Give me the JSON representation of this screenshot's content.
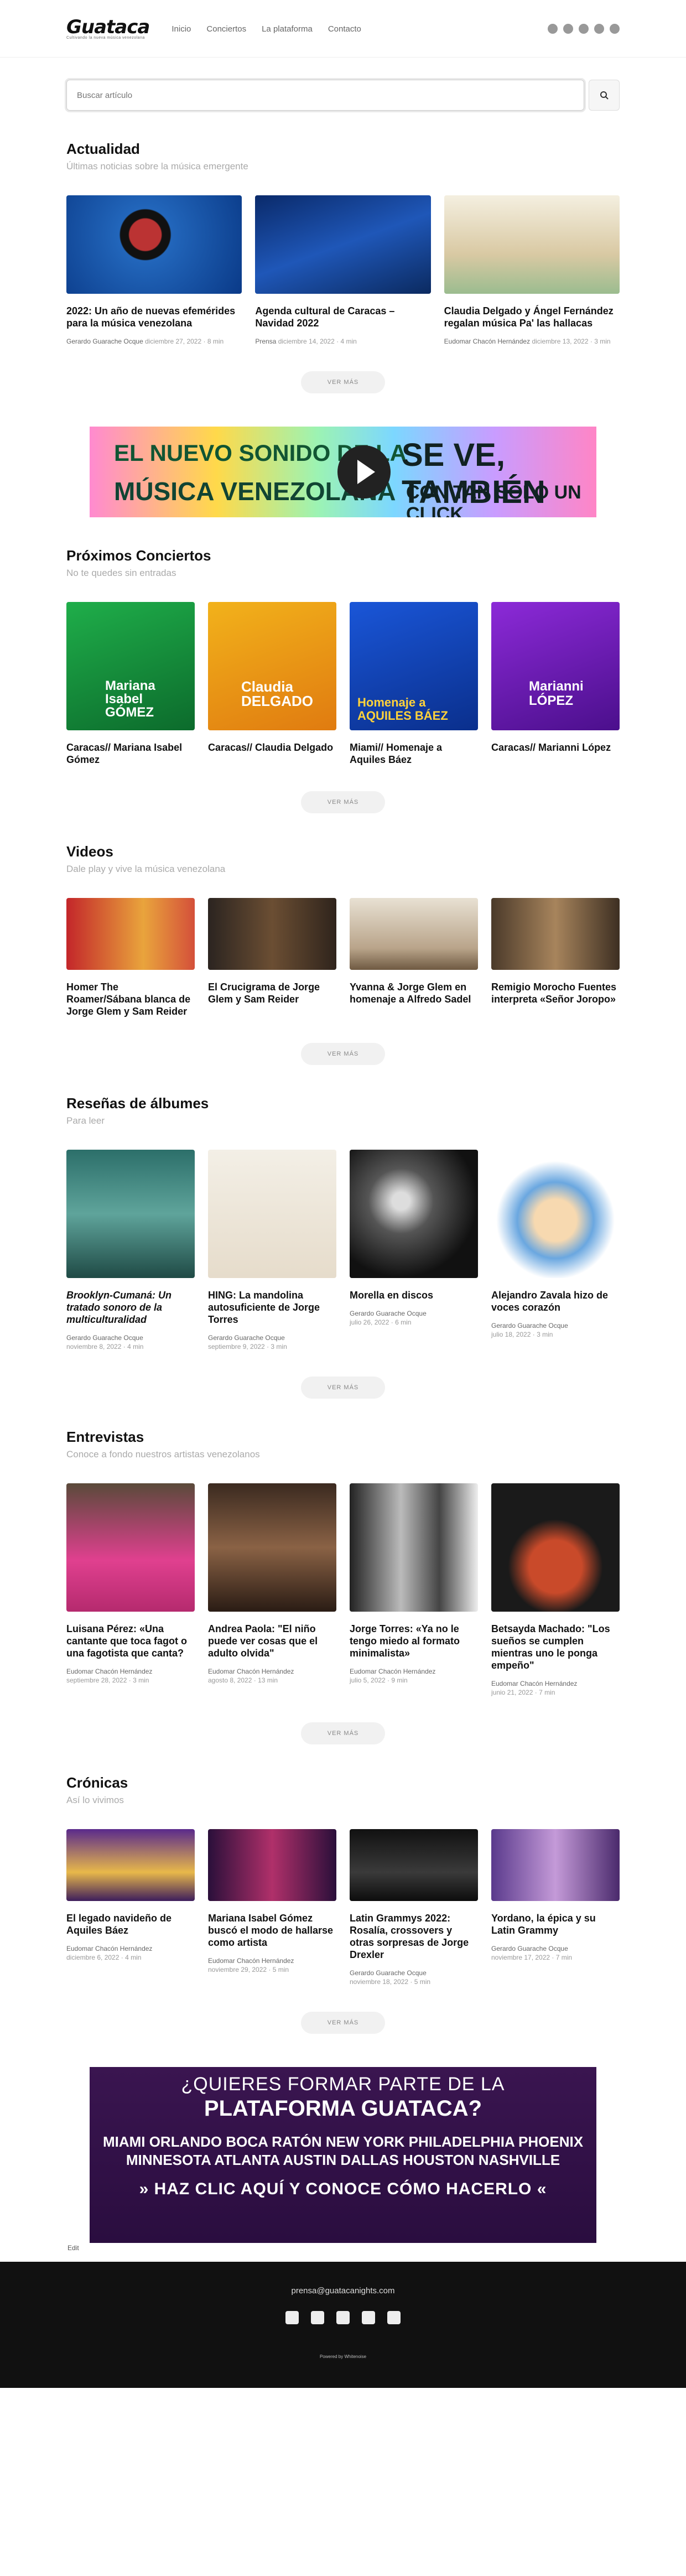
{
  "brand": {
    "name": "Guataca",
    "tagline": "Cultivando la nueva música venezolana"
  },
  "nav": [
    "Inicio",
    "Conciertos",
    "La plataforma",
    "Contacto"
  ],
  "search": {
    "placeholder": "Buscar artículo"
  },
  "actualidad": {
    "title": "Actualidad",
    "subtitle": "Últimas noticias sobre la música emergente",
    "cards": [
      {
        "title": "2022: Un año de nuevas efemérides para la música venezolana",
        "author": "Gerardo Guarache Ocque",
        "date": "diciembre 27, 2022",
        "read": "8 min"
      },
      {
        "title": "Agenda cultural de Caracas – Navidad 2022",
        "author": "Prensa",
        "date": "diciembre 14, 2022",
        "read": "4 min"
      },
      {
        "title": "Claudia Delgado y Ángel Fernández regalan música Pa' las hallacas",
        "author": "Eudomar Chacón Hernández",
        "date": "diciembre 13, 2022",
        "read": "3 min"
      }
    ]
  },
  "conciertos": {
    "title": "Próximos Conciertos",
    "subtitle": "No te quedes sin entradas",
    "cards": [
      {
        "title": "Caracas// Mariana Isabel Gómez",
        "poster": "Mariana Isabel GÓMEZ"
      },
      {
        "title": "Caracas// Claudia Delgado",
        "poster": "Claudia DELGADO"
      },
      {
        "title": "Miami// Homenaje a Aquiles Báez",
        "poster": "Homenaje a AQUILES BÁEZ"
      },
      {
        "title": "Caracas// Marianni López",
        "poster": "Marianni LÓPEZ"
      }
    ]
  },
  "videos": {
    "title": "Videos",
    "subtitle": "Dale play y vive la música venezolana",
    "cards": [
      {
        "title": "Homer The Roamer/Sábana blanca de Jorge Glem y Sam Reider"
      },
      {
        "title": "El Crucigrama de Jorge Glem y Sam Reider"
      },
      {
        "title": "Yvanna & Jorge Glem en homenaje a Alfredo Sadel"
      },
      {
        "title": "Remigio Morocho Fuentes interpreta «Señor Joropo»"
      }
    ]
  },
  "resenas": {
    "title": "Reseñas de álbumes",
    "subtitle": "Para leer",
    "cards": [
      {
        "title": "Brooklyn-Cumaná: Un tratado sonoro de la multiculturalidad",
        "author": "Gerardo Guarache Ocque",
        "date": "noviembre 8, 2022",
        "read": "4 min"
      },
      {
        "title": "HING: La mandolina autosuficiente de Jorge Torres",
        "author": "Gerardo Guarache Ocque",
        "date": "septiembre 9, 2022",
        "read": "3 min"
      },
      {
        "title": "Morella en discos",
        "author": "Gerardo Guarache Ocque",
        "date": "julio 26, 2022",
        "read": "6 min"
      },
      {
        "title": "Alejandro Zavala hizo de voces corazón",
        "author": "Gerardo Guarache Ocque",
        "date": "julio 18, 2022",
        "read": "3 min"
      }
    ]
  },
  "entrevistas": {
    "title": "Entrevistas",
    "subtitle": "Conoce a fondo nuestros artistas venezolanos",
    "cards": [
      {
        "title": "Luisana Pérez: «Una cantante que toca fagot o una fagotista que canta?",
        "author": "Eudomar Chacón Hernández",
        "date": "septiembre 28, 2022",
        "read": "3 min"
      },
      {
        "title": "Andrea Paola: \"El niño puede ver cosas que el adulto olvida\"",
        "author": "Eudomar Chacón Hernández",
        "date": "agosto 8, 2022",
        "read": "13 min"
      },
      {
        "title": "Jorge Torres: «Ya no le tengo miedo al formato minimalista»",
        "author": "Eudomar Chacón Hernández",
        "date": "julio 5, 2022",
        "read": "9 min"
      },
      {
        "title": "Betsayda Machado: \"Los sueños se cumplen mientras uno le ponga empeño\"",
        "author": "Eudomar Chacón Hernández",
        "date": "junio 21, 2022",
        "read": "7 min"
      }
    ]
  },
  "cronicas": {
    "title": "Crónicas",
    "subtitle": "Así lo vivimos",
    "cards": [
      {
        "title": "El legado navideño de Aquiles Báez",
        "author": "Eudomar Chacón Hernández",
        "date": "diciembre 6, 2022",
        "read": "4 min"
      },
      {
        "title": "Mariana Isabel Gómez buscó el modo de hallarse como artista",
        "author": "Eudomar Chacón Hernández",
        "date": "noviembre 29, 2022",
        "read": "5 min"
      },
      {
        "title": "Latin Grammys 2022: Rosalía, crossovers y otras sorpresas de Jorge Drexler",
        "author": "Gerardo Guarache Ocque",
        "date": "noviembre 18, 2022",
        "read": "5 min"
      },
      {
        "title": "Yordano, la épica y su Latin Grammy",
        "author": "Gerardo Guarache Ocque",
        "date": "noviembre 17, 2022",
        "read": "7 min"
      }
    ]
  },
  "more_label": "VER MÁS",
  "banner1": {
    "l1": "EL NUEVO SONIDO DE LA",
    "l2": "MÚSICA VENEZOLANA",
    "r1": "SE VE, TAMBIÉN",
    "r2": "CON TAN SOLO UN CLICK"
  },
  "banner2": {
    "b1": "¿QUIERES FORMAR PARTE DE LA",
    "b2": "PLATAFORMA GUATACA?",
    "b3": "MIAMI ORLANDO BOCA RATÓN NEW YORK PHILADELPHIA PHOENIX",
    "b4": "MINNESOTA ATLANTA AUSTIN DALLAS HOUSTON NASHVILLE",
    "b5": "» HAZ CLIC AQUÍ Y CONOCE CÓMO HACERLO «"
  },
  "edit_label": "Edit",
  "footer": {
    "email": "prensa@guatacanights.com",
    "credit": "Powered by Whitenoise"
  }
}
